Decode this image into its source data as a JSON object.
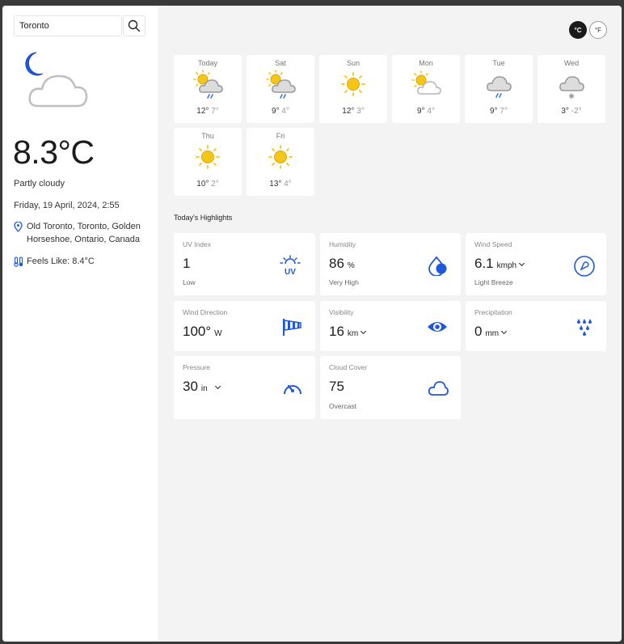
{
  "search": {
    "value": "Toronto"
  },
  "current": {
    "temp": "8.3°C",
    "condition": "Partly cloudy",
    "datetime": "Friday, 19 April, 2024, 2:55",
    "location": "Old Toronto, Toronto, Golden Horseshoe, Ontario, Canada",
    "feels_like": "Feels Like: 8.4°C",
    "icon": "partly-cloudy-night-icon"
  },
  "units": {
    "celsius": "°C",
    "fahrenheit": "°F"
  },
  "forecast": [
    {
      "day": "Today",
      "hi": "12°",
      "lo": "7°",
      "icon": "sun-cloud-rain"
    },
    {
      "day": "Sat",
      "hi": "9°",
      "lo": "4°",
      "icon": "sun-cloud-rain"
    },
    {
      "day": "Sun",
      "hi": "12°",
      "lo": "3°",
      "icon": "sun"
    },
    {
      "day": "Mon",
      "hi": "9°",
      "lo": "4°",
      "icon": "sun-cloud"
    },
    {
      "day": "Tue",
      "hi": "9°",
      "lo": "7°",
      "icon": "cloud-rain"
    },
    {
      "day": "Wed",
      "hi": "3°",
      "lo": "-2°",
      "icon": "cloud-snow"
    },
    {
      "day": "Thu",
      "hi": "10°",
      "lo": "2°",
      "icon": "sun"
    },
    {
      "day": "Fri",
      "hi": "13°",
      "lo": "4°",
      "icon": "sun"
    }
  ],
  "highlights": {
    "title": "Today's Highlights",
    "uv": {
      "label": "UV Index",
      "value": "1",
      "sub": "Low"
    },
    "humidity": {
      "label": "Humidity",
      "value": "86",
      "unit": "%",
      "sub": "Very High"
    },
    "wind_speed": {
      "label": "Wind Speed",
      "value": "6.1",
      "unit": "kmph",
      "sub": "Light Breeze"
    },
    "wind_dir": {
      "label": "Wind Direction",
      "value": "100°",
      "unit": "W"
    },
    "visibility": {
      "label": "Visibility",
      "value": "16",
      "unit": "km"
    },
    "precip": {
      "label": "Precipitation",
      "value": "0",
      "unit": "mm"
    },
    "pressure": {
      "label": "Pressure",
      "value": "30",
      "unit": "in"
    },
    "cloud": {
      "label": "Cloud Cover",
      "value": "75",
      "sub": "Overcast"
    }
  },
  "colors": {
    "accent": "#1f58d8",
    "sun": "#f5c518",
    "cloud": "#9a9a9a",
    "rain": "#3a7bd5"
  }
}
